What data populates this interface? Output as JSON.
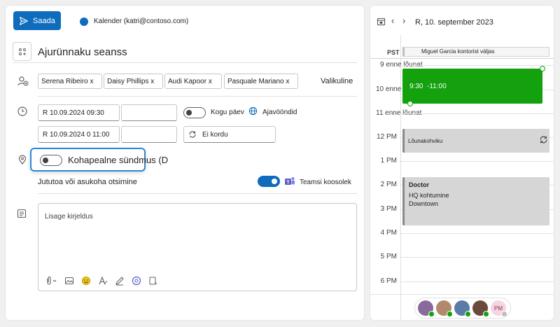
{
  "toolbar": {
    "send_label": "Saada",
    "calendar_label": "Kalender (katri@contoso.com)",
    "calendar_color": "#0f6cbd"
  },
  "event": {
    "title": "Ajurünnaku seanss",
    "attendees": [
      "Serena Ribeiro",
      "Daisy Phillips",
      "Audi Kapoor",
      "Pasquale Mariano"
    ],
    "remove_glyph": "x",
    "optional_label": "Valikuline",
    "start_date": "R 10.09.2024 09:30",
    "end_date": "R 10.09.2024 0 11:00",
    "all_day_label": "Kogu päev",
    "timezones_label": "Ajavööndid",
    "repeat_label": "Ei kordu",
    "location_label": "Kohapealne sündmus (D",
    "location_search": "Jututoa või asukoha otsimine",
    "teams_label": "Teamsi koosolek",
    "description_placeholder": "Lisage kirjeldus"
  },
  "calendar": {
    "date_label": "R, 10. september 2023",
    "timezone": "PST",
    "allday_event": "Miguel Garcia kontorist väljas",
    "hours": [
      "9 enne lõunat",
      "10 enne lõunat",
      "11 enne lõunat",
      "12 PM",
      "1 PM",
      "2 PM",
      "3 PM",
      "4 PM",
      "5 PM",
      "6 PM"
    ],
    "events": [
      {
        "title": "9:30  -11:00",
        "color": "#13a10e"
      },
      {
        "title": "Lõunakohviku",
        "color": "#d6d6d6"
      },
      {
        "title": "Doctor",
        "line2": "HQ kohtumine",
        "line3": "Downtown",
        "color": "#d6d6d6"
      }
    ],
    "avatars": [
      {
        "initials": "",
        "color": "#8a6a9a"
      },
      {
        "initials": "",
        "color": "#b08a6a"
      },
      {
        "initials": "",
        "color": "#5a7aa8"
      },
      {
        "initials": "",
        "color": "#6a4a3a"
      },
      {
        "initials": "PM",
        "color": "#f4d6e0"
      }
    ]
  }
}
